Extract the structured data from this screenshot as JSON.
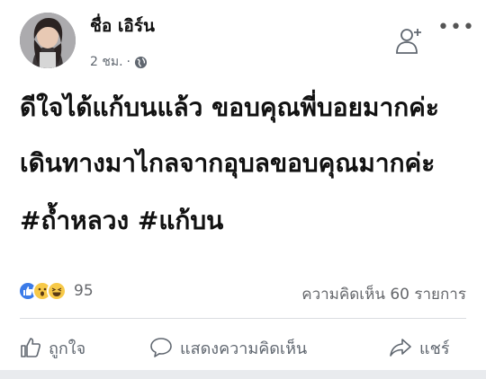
{
  "post": {
    "author_name": "ชื่อ เอิร์น",
    "timestamp": "2 ชม.",
    "separator": "·",
    "privacy_icon": "globe-icon",
    "lines": [
      "ดีใจได้แก้บนแล้ว ขอบคุณพี่บอยมากค่ะ",
      "เดินทางมาไกลจากอุบลขอบคุณมากค่ะ",
      "#ถ้ำหลวง #แก้บน"
    ],
    "reaction_icons": [
      "like-icon",
      "wow-icon",
      "haha-icon"
    ],
    "reaction_count": "95",
    "comment_count": "ความคิดเห็น 60 รายการ"
  },
  "actions": {
    "like_label": "ถูกใจ",
    "comment_label": "แสดงความคิดเห็น",
    "share_label": "แชร์"
  },
  "colors": {
    "like_blue": "#3b7be8",
    "reaction_yellow": "#f7c948",
    "secondary_text": "#606770"
  }
}
